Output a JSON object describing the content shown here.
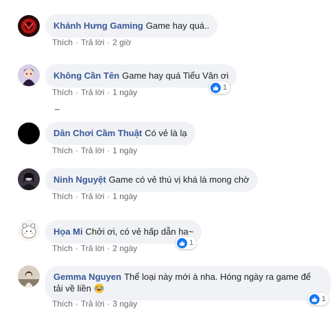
{
  "comments": [
    {
      "author": "Khánh Hưng Gaming",
      "text": "Game hay quá..",
      "like": "Thích",
      "reply": "Trả lời",
      "time": "2 giờ",
      "reactions": ""
    },
    {
      "author": "Không Cần Tên",
      "text": "Game hay quá Tiểu Vân ơi",
      "like": "Thích",
      "reply": "Trả lời",
      "time": "1 ngày",
      "reactions": "1"
    },
    {
      "author": "Dân Chơi Cầm Thuật",
      "text": "Có vẻ là lạ",
      "like": "Thích",
      "reply": "Trả lời",
      "time": "1 ngày",
      "reactions": ""
    },
    {
      "author": "Ninh Nguyệt",
      "text": "Game có vẻ thú vị khá là mong chờ",
      "like": "Thích",
      "reply": "Trả lời",
      "time": "1 ngày",
      "reactions": ""
    },
    {
      "author": "Họa Mi",
      "text": "Chởi ơi, có vẻ hấp dẫn ha~",
      "like": "Thích",
      "reply": "Trả lời",
      "time": "2 ngày",
      "reactions": "1"
    },
    {
      "author": "Gemma Nguyen",
      "text": "Thể loại này mới à nha. Hóng ngày ra game để tải về liền",
      "like": "Thích",
      "reply": "Trả lời",
      "time": "3 ngày",
      "reactions": "1"
    }
  ],
  "separator": "–",
  "colors": {
    "author": "#385898",
    "bubble": "#f0f2f5",
    "like": "#1877f2",
    "meta": "#65676b"
  }
}
